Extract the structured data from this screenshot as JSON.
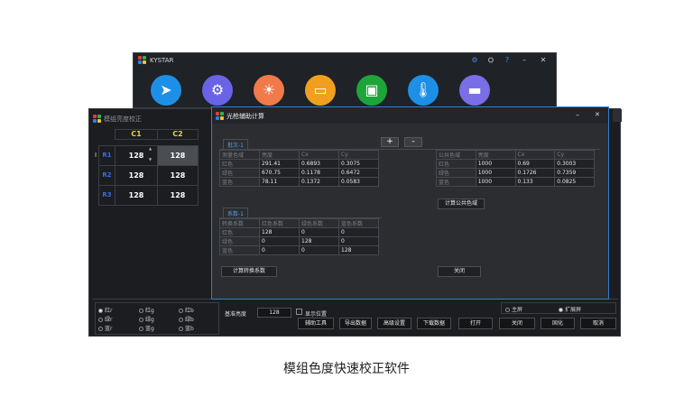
{
  "app": {
    "title": "KYSTAR",
    "title_buttons": [
      "⚙",
      "⛭",
      "?",
      "–",
      "✕"
    ],
    "icons": [
      {
        "name": "send-icon",
        "color": "#1e8fe6",
        "glyph": "➤"
      },
      {
        "name": "display-settings-icon",
        "color": "#6a63e6",
        "glyph": "⚙"
      },
      {
        "name": "brightness-icon",
        "color": "#f07a4a",
        "glyph": "☀"
      },
      {
        "name": "screen-icon",
        "color": "#f0a01e",
        "glyph": "▭"
      },
      {
        "name": "image-icon",
        "color": "#1ea53a",
        "glyph": "▣"
      },
      {
        "name": "temperature-icon",
        "color": "#1e8fe6",
        "glyph": "🌡"
      },
      {
        "name": "device-icon",
        "color": "#7a6ee6",
        "glyph": "▬"
      }
    ]
  },
  "left_window": {
    "title": "模组亮度校正",
    "col_headers": [
      "C1",
      "C2"
    ],
    "row_labels": [
      "R1",
      "R2",
      "R3"
    ],
    "cells": [
      [
        "128",
        "128"
      ],
      [
        "128",
        "128"
      ],
      [
        "128",
        "128"
      ]
    ],
    "row_marker": "I",
    "stepper_up": "▲",
    "stepper_down": "▼"
  },
  "dialog": {
    "title": "光枪辅助计算",
    "tab_batch": "批次-1",
    "add_label": "+",
    "remove_label": "-",
    "measure_headers": [
      "测量色域",
      "亮度",
      "Cx",
      "Cy"
    ],
    "measure_rows": [
      [
        "红色",
        "291.41",
        "0.6893",
        "0.3075"
      ],
      [
        "绿色",
        "670.75",
        "0.1178",
        "0.6472"
      ],
      [
        "蓝色",
        "78.11",
        "0.1372",
        "0.0583"
      ]
    ],
    "public_headers": [
      "公共色域",
      "亮度",
      "Cx",
      "Cy"
    ],
    "public_rows": [
      [
        "红色",
        "1000",
        "0.69",
        "0.3003"
      ],
      [
        "绿色",
        "1000",
        "0.1726",
        "0.7359"
      ],
      [
        "蓝色",
        "1000",
        "0.133",
        "0.0825"
      ]
    ],
    "calc_public_label": "计算公共色域",
    "tab_coef": "系数-1",
    "coef_headers": [
      "转换系数",
      "红色系数",
      "绿色系数",
      "蓝色系数"
    ],
    "coef_rows": [
      [
        "红色",
        "128",
        "0",
        "0"
      ],
      [
        "绿色",
        "0",
        "128",
        "0"
      ],
      [
        "蓝色",
        "0",
        "0",
        "128"
      ]
    ],
    "calc_coef_label": "计算转换系数",
    "close_label": "关闭",
    "min_label": "–",
    "x_label": "✕"
  },
  "bottom": {
    "radios": [
      [
        "红r",
        "红g",
        "红b"
      ],
      [
        "绿r",
        "绿g",
        "绿b"
      ],
      [
        "蓝r",
        "蓝g",
        "蓝b"
      ]
    ],
    "base_brightness_label": "基准亮度",
    "base_brightness_value": "128",
    "show_position_label": "显示位置",
    "main_screen_label": "主屏",
    "ext_screen_label": "扩展屏",
    "buttons": [
      "辅助工具",
      "导出数据",
      "高级设置",
      "下载数据",
      "打开",
      "关闭",
      "固化",
      "取消"
    ]
  },
  "caption": "模组色度快速校正软件"
}
